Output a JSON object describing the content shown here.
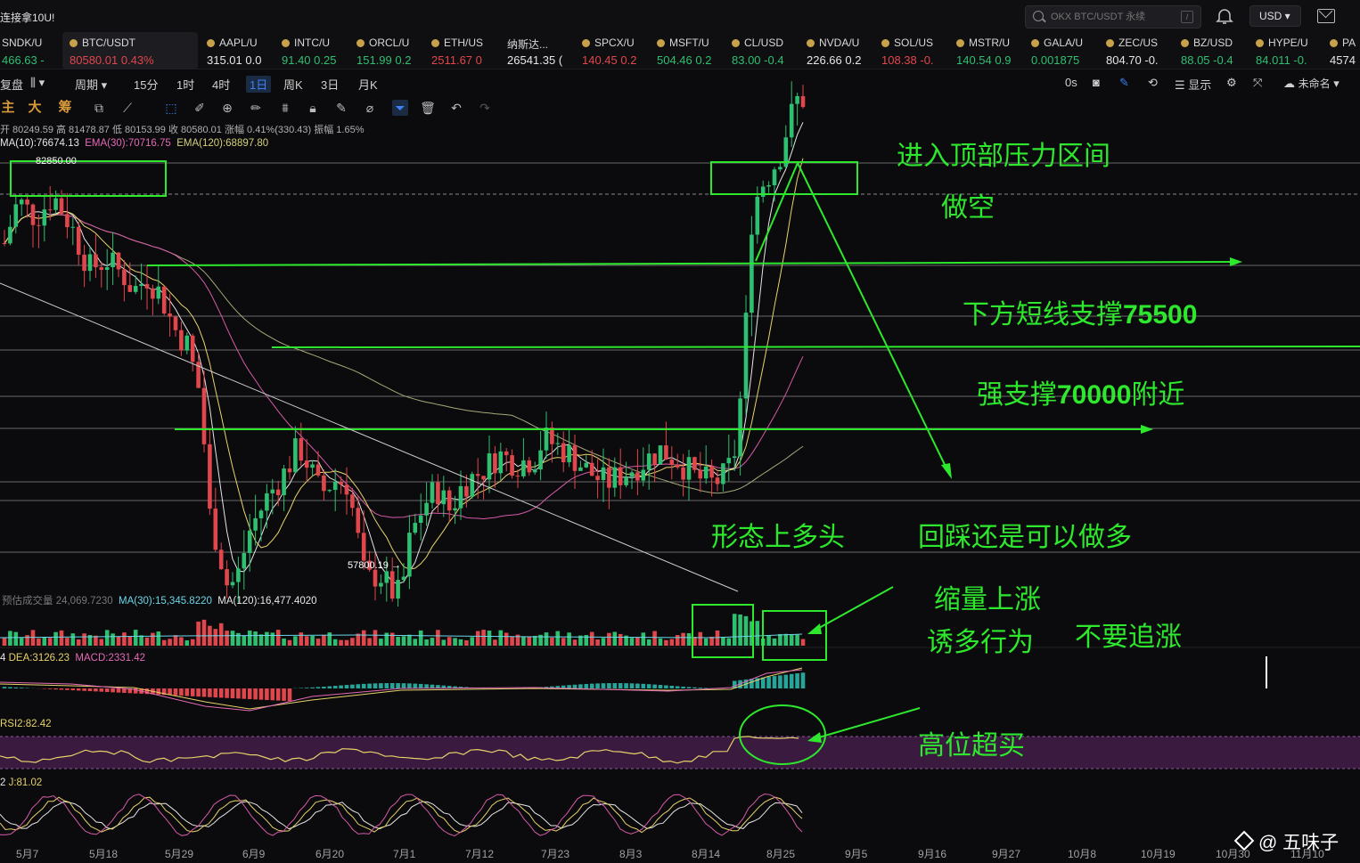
{
  "topbar": {
    "promo": "连接拿10U!",
    "search_placeholder": "OKX BTC/USDT 永续",
    "search_shortcut": "/",
    "currency": "USD ▾"
  },
  "tickers": [
    {
      "name": "SNDK/U",
      "price": "466.63 -",
      "tone": "up"
    },
    {
      "name": "BTC/USDT",
      "price": "80580.01  0.43%",
      "tone": "dn",
      "active": true
    },
    {
      "name": "AAPL/U",
      "price": "315.01  0.0",
      "tone": "wt"
    },
    {
      "name": "INTC/U",
      "price": "91.40  0.25",
      "tone": "up"
    },
    {
      "name": "ORCL/U",
      "price": "151.99  0.2",
      "tone": "up"
    },
    {
      "name": "ETH/US",
      "price": "2511.67  0",
      "tone": "dn"
    },
    {
      "name": "纳斯达...",
      "price": "26541.35 (",
      "tone": "wt"
    },
    {
      "name": "SPCX/U",
      "price": "140.45  0.2",
      "tone": "dn"
    },
    {
      "name": "MSFT/U",
      "price": "504.46  0.2",
      "tone": "up"
    },
    {
      "name": "CL/USD",
      "price": "83.00  -0.4",
      "tone": "up"
    },
    {
      "name": "NVDA/U",
      "price": "226.66  0.2",
      "tone": "wt"
    },
    {
      "name": "SOL/US",
      "price": "108.38  -0.",
      "tone": "dn"
    },
    {
      "name": "MSTR/U",
      "price": "140.54  0.9",
      "tone": "up"
    },
    {
      "name": "GALA/U",
      "price": "0.001875",
      "tone": "up"
    },
    {
      "name": "ZEC/US",
      "price": "804.70  -0.",
      "tone": "wt"
    },
    {
      "name": "BZ/USD",
      "price": "88.05  -0.4",
      "tone": "up"
    },
    {
      "name": "HYPE/U",
      "price": "84.011  -0.",
      "tone": "up"
    },
    {
      "name": "PA",
      "price": "4574",
      "tone": "wt"
    }
  ],
  "toolbar": {
    "tabs": [
      "复盘",
      "周期",
      "15分",
      "1时",
      "4时",
      "1日",
      "周K",
      "3日",
      "月K"
    ],
    "active_tab": "1日",
    "right": [
      "0s",
      "显示",
      "未命名"
    ],
    "indicator_labels": [
      "主",
      "大",
      "筹"
    ]
  },
  "ohlc": "开 80249.59  高 81478.87  低 80153.99  收 80580.01  涨幅 0.41%(330.43)  振幅 1.65%",
  "ma_line": {
    "ma": "MA(10):76674.13",
    "ema30": "EMA(30):70716.75",
    "ema120": "EMA(120):68897.80"
  },
  "price_labels": {
    "high": "82850.00",
    "low": "57800.19 →"
  },
  "volume_line": {
    "est": "预估成交量 24,069.7230",
    "ma30": "MA(30):15,345.8220",
    "ma120": "MA(120):16,477.4020"
  },
  "macd_line": {
    "dea": "DEA:3126.23",
    "macd": "MACD:2331.42"
  },
  "rsi_line": "RSI2:82.42",
  "kdj_line": "J:81.02",
  "x_axis": [
    "5月7",
    "5月18",
    "5月29",
    "6月9",
    "6月20",
    "7月1",
    "7月12",
    "7月23",
    "8月3",
    "8月14",
    "8月25",
    "9月5",
    "9月16",
    "9月27",
    "10月8",
    "10月19",
    "10月30",
    "11月10"
  ],
  "annotations": {
    "a1": "进入顶部压力区间",
    "a2": "做空",
    "a3_text": "下方短线支撑",
    "a3_num": "75500",
    "a4_text": "强支撑",
    "a4_num": "70000",
    "a4_tail": "附近",
    "a5": "形态上多头",
    "a6": "回踩还是可以做多",
    "a7": "缩量上涨",
    "a8": "诱多行为",
    "a9": "不要追涨",
    "a10": "高位超买"
  },
  "watermark": "@ 五味子",
  "colors": {
    "up": "#2fbf71",
    "down": "#e0474c",
    "annotation": "#2ee82e",
    "accent": "#3b82f6"
  },
  "chart_data": {
    "type": "candlestick",
    "title": "BTC/USDT 1日",
    "series": [
      {
        "name": "BTC/USDT",
        "values": [
          {
            "x": "5月7",
            "close": 79800
          },
          {
            "x": "5月18",
            "close": 77000
          },
          {
            "x": "5月29",
            "close": 73000
          },
          {
            "x": "6月9",
            "close": 64000
          },
          {
            "x": "6月20",
            "close": 66500
          },
          {
            "x": "7月1",
            "close": 59000
          },
          {
            "x": "7月12",
            "close": 66500
          },
          {
            "x": "7月23",
            "close": 66800
          },
          {
            "x": "8月3",
            "close": 66300
          },
          {
            "x": "8月14",
            "close": 70000
          },
          {
            "x": "8月25",
            "close": 80580
          }
        ]
      }
    ],
    "key_levels": {
      "resistance_high": 82850.0,
      "low": 57800.19,
      "short_support": 75500,
      "strong_support": 70000
    },
    "grid": true
  }
}
